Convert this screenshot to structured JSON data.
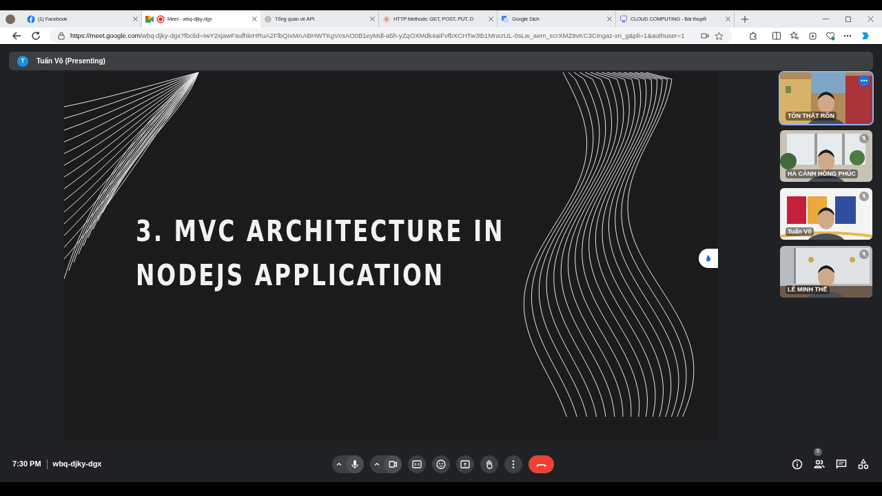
{
  "browser": {
    "tabs": [
      {
        "title": "(1) Facebook",
        "selected": false,
        "kind": "facebook"
      },
      {
        "title": "Meet - wbq-djky-dgx",
        "selected": true,
        "kind": "meet"
      },
      {
        "title": "Tổng quan về API",
        "selected": false,
        "kind": "globe"
      },
      {
        "title": "HTTP Methods: GET, POST, PUT, D",
        "selected": false,
        "kind": "star"
      },
      {
        "title": "Google Dịch",
        "selected": false,
        "kind": "translate"
      },
      {
        "title": "CLOUD COMPUTING - Bài thuyết",
        "selected": false,
        "kind": "badge"
      }
    ],
    "url_host": "https://meet.google.com",
    "url_rest": "/wbq-djky-dgx?fbclid=IwY2xjawFsufhleHRuA2FlbQIxMAABHWTKgVcsAO0B1eyMdl-a5h-yZqOXMdk4aiFvfbXCHTw3tb1MnxzUL-0sLw_aem_scrXMZ9vKC3CIngaz-xn_g&pli=1&authuser=1"
  },
  "meet": {
    "presenter": {
      "initial": "T",
      "label": "Tuấn Võ (Presenting)"
    },
    "slide": {
      "title_lines": [
        "3. MVC ARCHITECTURE IN",
        "NODEJS APPLICATION"
      ]
    },
    "participants": [
      {
        "name": "TÔN THẤT RÔN",
        "speaking": true,
        "muted": false,
        "kind": "street"
      },
      {
        "name": "HÀ CẢNH HỒNG PHÚC",
        "speaking": false,
        "muted": true,
        "kind": "room"
      },
      {
        "name": "Tuấn Võ",
        "speaking": false,
        "muted": true,
        "kind": "logo"
      },
      {
        "name": "LÊ MINH THẾ",
        "speaking": false,
        "muted": true,
        "kind": "window"
      }
    ],
    "time": "7:30 PM",
    "meeting_code": "wbq-djky-dgx",
    "people_count": "5"
  }
}
